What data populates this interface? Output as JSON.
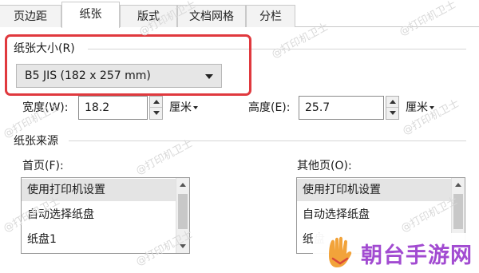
{
  "tabs": [
    "页边距",
    "纸张",
    "版式",
    "文档网格",
    "分栏"
  ],
  "paper_size": {
    "label": "纸张大小(R)",
    "value": "B5 JIS (182 x 257 mm)"
  },
  "width": {
    "label": "宽度(W):",
    "value": "18.2",
    "unit": "厘米"
  },
  "height": {
    "label": "高度(E):",
    "value": "25.7",
    "unit": "厘米"
  },
  "paper_source": {
    "title": "纸张来源",
    "first_page": {
      "label": "首页(F):",
      "items": [
        "使用打印机设置",
        "自动选择纸盘",
        "纸盘1"
      ]
    },
    "other_pages": {
      "label": "其他页(O):",
      "items": [
        "使用打印机设置",
        "自动选择纸盘",
        "纸盘"
      ]
    }
  },
  "watermark": "@打印机卫士",
  "logo": {
    "text": "朝台手游网"
  },
  "colors": {
    "highlight": "#e0393e",
    "logo_text": "#a24bd1",
    "logo_hand": "#f2a33a"
  }
}
